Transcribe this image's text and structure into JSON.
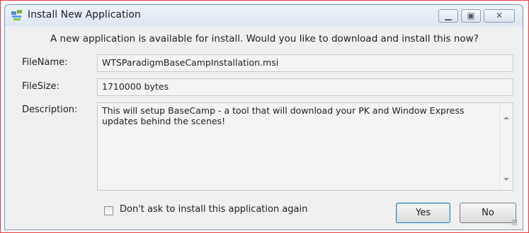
{
  "window": {
    "title": "Install New Application",
    "icon": "install-app-icon",
    "controls": {
      "minimize": "minimize-icon",
      "maximize": "maximize-icon",
      "close": "close-icon"
    }
  },
  "dialog": {
    "prompt": "A new application is available for install.  Would you like to download and install this now?",
    "file_name_label": "FileName:",
    "file_name_value": "WTSParadigmBaseCampInstallation.msi",
    "file_size_label": "FileSize:",
    "file_size_value": "1710000 bytes",
    "description_label": "Description:",
    "description_value": "This will setup BaseCamp - a tool that will download your PK and Window Express updates behind the scenes!",
    "dont_ask_label": "Don't ask to install this application again",
    "dont_ask_checked": false,
    "yes_label": "Yes",
    "no_label": "No"
  },
  "colors": {
    "highlight_border": "#e23b3b",
    "default_button_border": "#3c7fb1"
  }
}
